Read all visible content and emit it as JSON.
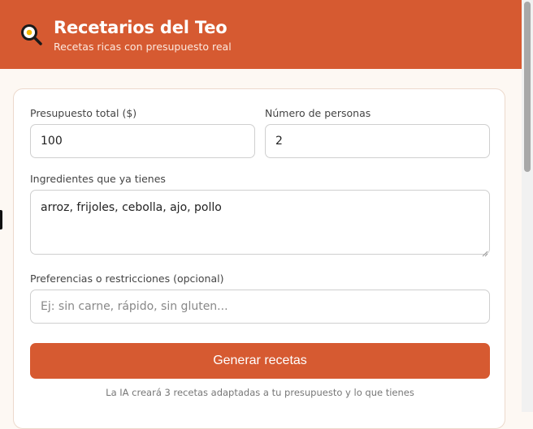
{
  "header": {
    "icon": "frying-pan-egg-icon",
    "title": "Recetarios del Teo",
    "subtitle": "Recetas ricas con presupuesto real"
  },
  "form": {
    "budget": {
      "label": "Presupuesto total ($)",
      "value": "100"
    },
    "people": {
      "label": "Número de personas",
      "value": "2"
    },
    "ingredients": {
      "label": "Ingredientes que ya tienes",
      "value": "arroz, frijoles, cebolla, ajo, pollo"
    },
    "preferences": {
      "label": "Preferencias o restricciones (opcional)",
      "value": "",
      "placeholder": "Ej: sin carne, rápido, sin gluten..."
    },
    "submit_label": "Generar recetas",
    "hint": "La IA creará 3 recetas adaptadas a tu presupuesto y lo que tienes"
  },
  "colors": {
    "accent": "#d65a31",
    "background": "#fdf8f3"
  }
}
